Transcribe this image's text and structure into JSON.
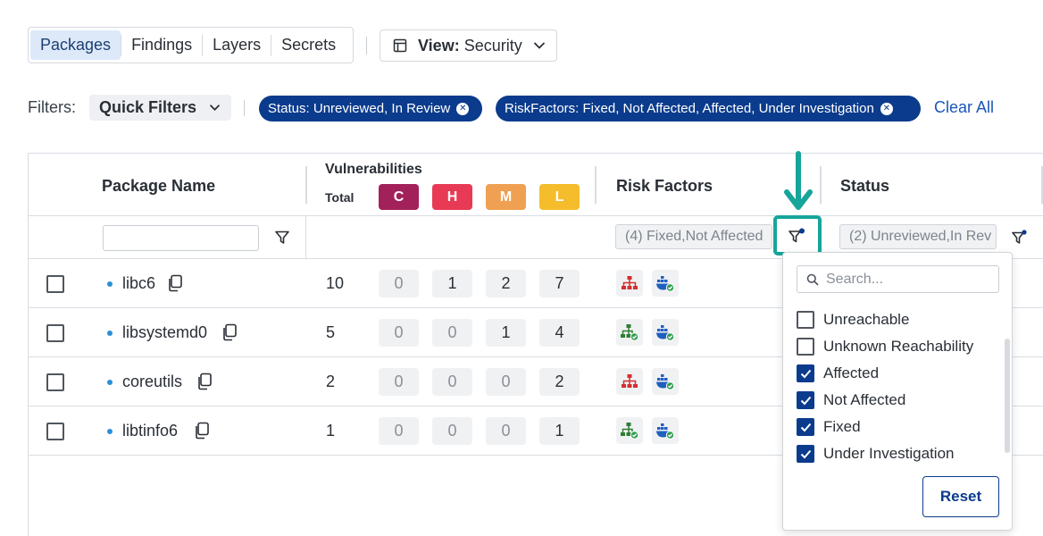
{
  "tabs": [
    {
      "label": "Packages",
      "active": true
    },
    {
      "label": "Findings",
      "active": false
    },
    {
      "label": "Layers",
      "active": false
    },
    {
      "label": "Secrets",
      "active": false
    }
  ],
  "view": {
    "label": "View:",
    "value": "Security"
  },
  "filters": {
    "label": "Filters:",
    "quick_filters": "Quick Filters",
    "chips": [
      "Status: Unreviewed, In Review",
      "RiskFactors: Fixed, Not Affected, Affected, Under Investigation"
    ],
    "clear_all": "Clear All"
  },
  "table": {
    "headers": {
      "package_name": "Package Name",
      "vulnerabilities": "Vulnerabilities",
      "total": "Total",
      "risk_factors": "Risk Factors",
      "status": "Status"
    },
    "severity": [
      {
        "label": "C",
        "color": "#a3215a"
      },
      {
        "label": "H",
        "color": "#e83a55"
      },
      {
        "label": "M",
        "color": "#f0a052"
      },
      {
        "label": "L",
        "color": "#f5bc2c"
      }
    ],
    "risk_filter_value": "(4) Fixed,Not Affected",
    "status_filter_value": "(2) Unreviewed,In Rev",
    "rows": [
      {
        "name": "libc6",
        "total": "10",
        "c": "0",
        "h": "1",
        "m": "2",
        "l": "7",
        "rf1_color": "#d32f2f"
      },
      {
        "name": "libsystemd0",
        "total": "5",
        "c": "0",
        "h": "0",
        "m": "1",
        "l": "4",
        "rf1_color": "#2e7d32"
      },
      {
        "name": "coreutils",
        "total": "2",
        "c": "0",
        "h": "0",
        "m": "0",
        "l": "2",
        "rf1_color": "#d32f2f"
      },
      {
        "name": "libtinfo6",
        "total": "1",
        "c": "0",
        "h": "0",
        "m": "0",
        "l": "1",
        "rf1_color": "#2e7d32"
      }
    ]
  },
  "dropdown": {
    "search_placeholder": "Search...",
    "options": [
      {
        "label": "Unreachable",
        "checked": false
      },
      {
        "label": "Unknown Reachability",
        "checked": false
      },
      {
        "label": "Affected",
        "checked": true
      },
      {
        "label": "Not Affected",
        "checked": true
      },
      {
        "label": "Fixed",
        "checked": true
      },
      {
        "label": "Under Investigation",
        "checked": true
      }
    ],
    "reset": "Reset"
  },
  "colors": {
    "accent": "#0b3b8c",
    "highlight": "#16a59a",
    "link": "#1a56b8"
  }
}
